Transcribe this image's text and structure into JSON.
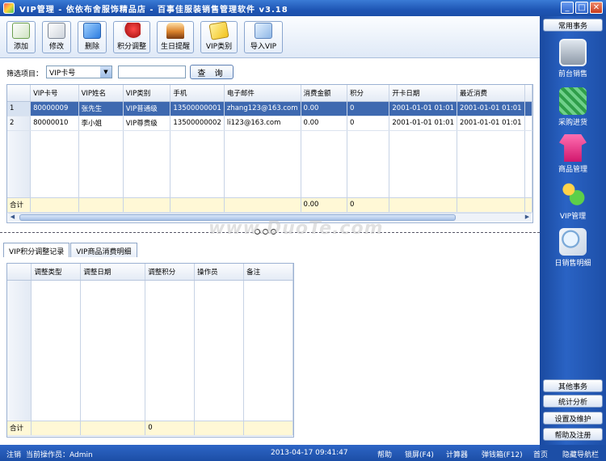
{
  "window": {
    "title": "VIP管理 - 依依布舍服饰精品店 - 百事佳服装销售管理软件 v3.18",
    "minimize_label": "_",
    "maximize_label": "□",
    "close_label": "✕"
  },
  "toolbar": {
    "add": "添加",
    "edit": "修改",
    "delete": "删除",
    "points_adjust": "积分调整",
    "birthday_reminder": "生日提醒",
    "vip_category": "VIP类别",
    "import_vip": "导入VIP"
  },
  "filter": {
    "label": "筛选项目：",
    "selected": "VIP卡号",
    "query_button": "查 询",
    "search_value": ""
  },
  "vip_grid": {
    "columns": [
      "VIP卡号",
      "VIP姓名",
      "VIP类别",
      "手机",
      "电子邮件",
      "消费金额",
      "积分",
      "开卡日期",
      "最近消费"
    ],
    "rows": [
      {
        "num": "1",
        "cells": [
          "80000009",
          "张先生",
          "VIP普通级",
          "13500000001",
          "zhang123@163.com",
          "0.00",
          "0",
          "2001-01-01 01:01",
          "2001-01-01 01:01"
        ]
      },
      {
        "num": "2",
        "cells": [
          "80000010",
          "李小姐",
          "VIP尊贵级",
          "13500000002",
          "li123@163.com",
          "0.00",
          "0",
          "2001-01-01 01:01",
          "2001-01-01 01:01"
        ]
      }
    ],
    "total_label": "合计",
    "total_amount": "0.00",
    "total_points": "0"
  },
  "tabs": [
    {
      "label": "VIP积分调整记录",
      "active": true
    },
    {
      "label": "VIP商品消费明细",
      "active": false
    }
  ],
  "adjust_grid": {
    "columns": [
      "调整类型",
      "调整日期",
      "调整积分",
      "操作员",
      "备注"
    ],
    "total_label": "合计",
    "total_points": "0"
  },
  "right_panel": {
    "common_header": "常用事务",
    "items": [
      {
        "label": "前台销售",
        "icon": "laptop-icon"
      },
      {
        "label": "采购进货",
        "icon": "basket-icon"
      },
      {
        "label": "商品管理",
        "icon": "shirt-icon"
      },
      {
        "label": "VIP管理",
        "icon": "users-icon"
      },
      {
        "label": "日销售明细",
        "icon": "magnifier-icon"
      }
    ],
    "other_header": "其他事务",
    "stats": "统计分析",
    "settings": "设置及维护",
    "help": "帮助及注册"
  },
  "status": {
    "register": "注销",
    "operator": "当前操作员：Admin",
    "datetime": "2013-04-17 09:41:47",
    "help": "帮助",
    "lock": "锁屏(F4)",
    "calculator": "计算器",
    "cash_box": "弹钱箱(F12)",
    "home": "首页",
    "hide_nav": "隐藏导航栏"
  },
  "watermark": "www.DuoTe.com"
}
